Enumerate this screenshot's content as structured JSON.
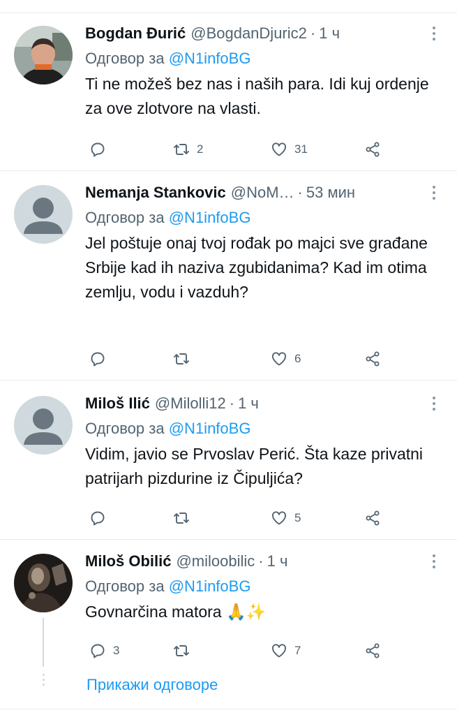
{
  "reply_prefix": "Одговор за",
  "tweets": [
    {
      "name": "Bogdan Đurić",
      "handle": "@BogdanDjuric2",
      "time": "1 ч",
      "reply_to": "@N1infoBG",
      "text": "Ti ne možeš bez nas i naših para. Idi kuj ordenje za ove zlotvore na vlasti.",
      "replies": "",
      "retweets": "2",
      "likes": "31",
      "avatar": "photo-man-icon"
    },
    {
      "name": "Nemanja Stankovic",
      "handle": "@NoM…",
      "time": "53 мин",
      "reply_to": "@N1infoBG",
      "text": "Jel poštuje onaj tvoj rođak po majci sve građane Srbije kad ih naziva zgubidanima? Kad im otima zemlju, vodu i vazduh?",
      "replies": "",
      "retweets": "",
      "likes": "6",
      "avatar": "default-avatar-icon"
    },
    {
      "name": "Miloš Ilić",
      "handle": "@Milolli12",
      "time": "1 ч",
      "reply_to": "@N1infoBG",
      "text": "Vidim, javio se Prvoslav Perić. Šta kaze privatni patrijarh pizdurine iz Čipuljića?",
      "replies": "",
      "retweets": "",
      "likes": "5",
      "avatar": "default-avatar-icon"
    },
    {
      "name": "Miloš Obilić",
      "handle": "@miloobilic",
      "time": "1 ч",
      "reply_to": "@N1infoBG",
      "text": "Govnarčina matora 🙏✨",
      "replies": "3",
      "retweets": "",
      "likes": "7",
      "avatar": "photo-dark-icon"
    }
  ],
  "show_replies": "Прикажи одговоре",
  "colors": {
    "accent": "#1d9bf0",
    "muted": "#536471",
    "divider": "#e6ecf0"
  }
}
